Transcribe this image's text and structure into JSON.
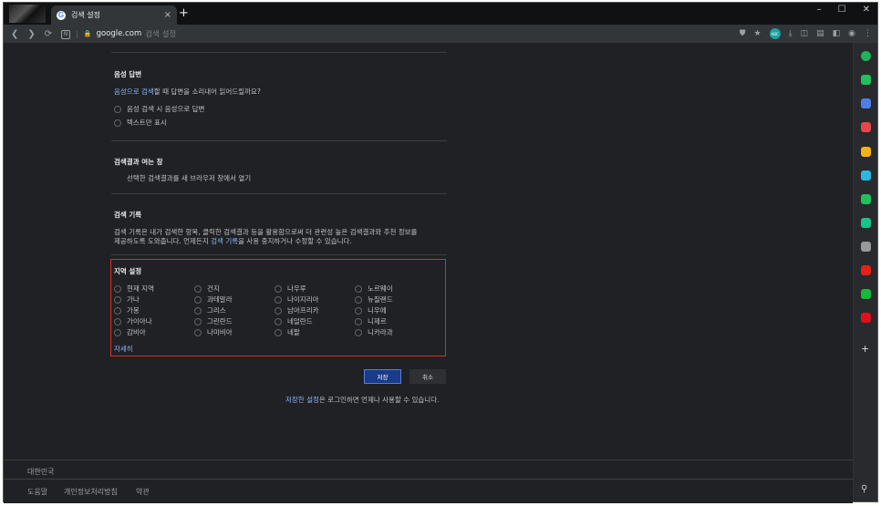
{
  "browser": {
    "tab_title": "검색 설정",
    "tab_close": "×",
    "new_tab": "+",
    "url_domain": "google.com",
    "url_path": "검색 설정",
    "n_badge": "N",
    "window_controls": [
      "–",
      "☐",
      "✕"
    ],
    "toolbar_badge": "ABC"
  },
  "sections": {
    "voice": {
      "title": "음성 답변",
      "desc_link": "음성으로 검색",
      "desc_rest": "할 때 답변을 소리내어 읽어드릴까요?",
      "options": [
        "음성 검색 시 음성으로 답변",
        "텍스트만 표시"
      ]
    },
    "results_window": {
      "title": "검색결과 여는 창",
      "option": "선택한 검색결과를 새 브라우저 창에서 열기"
    },
    "history": {
      "title": "검색 기록",
      "line1": "검색 기록은 내가 검색한 항목, 클릭한 검색결과 등을 활용함으로써 더 관련성 높은 검색결과와 추천 정보를",
      "line2_pre": "제공하도록 도와줍니다. 언제든지 ",
      "line2_link": "검색 기록",
      "line2_post": "을 사용 중지하거나 수정할 수 있습니다."
    },
    "region": {
      "title": "지역 설정",
      "columns": [
        [
          "현재 지역",
          "가나",
          "가봉",
          "가이아나",
          "감비아"
        ],
        [
          "건지",
          "과테말라",
          "그리스",
          "그린란드",
          "나미비아"
        ],
        [
          "나우루",
          "나이지리아",
          "남아프리카",
          "네덜란드",
          "네팔"
        ],
        [
          "노르웨이",
          "뉴질랜드",
          "니우에",
          "니제르",
          "니카라과"
        ]
      ],
      "more": "자세히"
    }
  },
  "buttons": {
    "save": "저장",
    "cancel": "취소"
  },
  "saved_note": {
    "link": "저장한 설정",
    "rest": "은 로그인하면 언제나 사용할 수 있습니다."
  },
  "footer": {
    "country": "대한민국",
    "links": [
      "도움말",
      "개인정보처리방침",
      "약관"
    ]
  },
  "sidebar_icons": [
    {
      "name": "whale-icon",
      "color": "#1fb45a"
    },
    {
      "name": "notification-icon",
      "color": "#20c15d"
    },
    {
      "name": "wallet-icon",
      "color": "#4f7ee8"
    },
    {
      "name": "pocket-icon",
      "color": "#e8474a"
    },
    {
      "name": "star-icon",
      "color": "#f3b21b"
    },
    {
      "name": "translate-icon",
      "color": "#2db7e0"
    },
    {
      "name": "calendar-icon",
      "color": "#20c15d"
    },
    {
      "name": "music-icon",
      "color": "#19c38a"
    },
    {
      "name": "avatar-icon",
      "color": "#999999"
    },
    {
      "name": "youtube-icon",
      "color": "#e62117"
    },
    {
      "name": "line-icon",
      "color": "#18b83a"
    },
    {
      "name": "nexon-icon",
      "color": "#e0111b"
    }
  ]
}
